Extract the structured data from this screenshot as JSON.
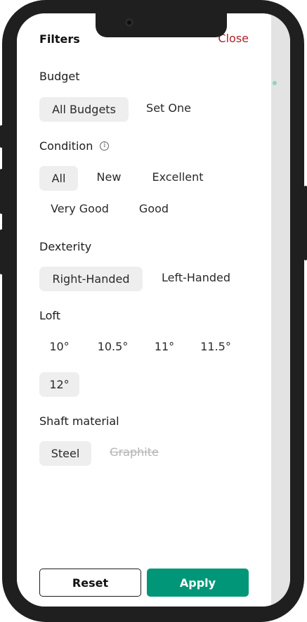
{
  "header": {
    "title": "Filters",
    "close_label": "Close"
  },
  "sections": {
    "budget": {
      "label": "Budget",
      "options": [
        "All Budgets",
        "Set One"
      ]
    },
    "condition": {
      "label": "Condition",
      "info_icon": "info-icon",
      "options": [
        "All",
        "New",
        "Excellent",
        "Very Good",
        "Good"
      ]
    },
    "dexterity": {
      "label": "Dexterity",
      "options": [
        "Right-Handed",
        "Left-Handed"
      ]
    },
    "loft": {
      "label": "Loft",
      "options": [
        "10°",
        "10.5°",
        "11°",
        "11.5°",
        "12°"
      ]
    },
    "shaft_material": {
      "label": "Shaft material",
      "options": [
        "Steel",
        "Graphite"
      ]
    }
  },
  "footer": {
    "reset_label": "Reset",
    "apply_label": "Apply"
  },
  "colors": {
    "accent": "#009677",
    "close": "#b0202a",
    "selected_chip": "#eeeeee"
  }
}
